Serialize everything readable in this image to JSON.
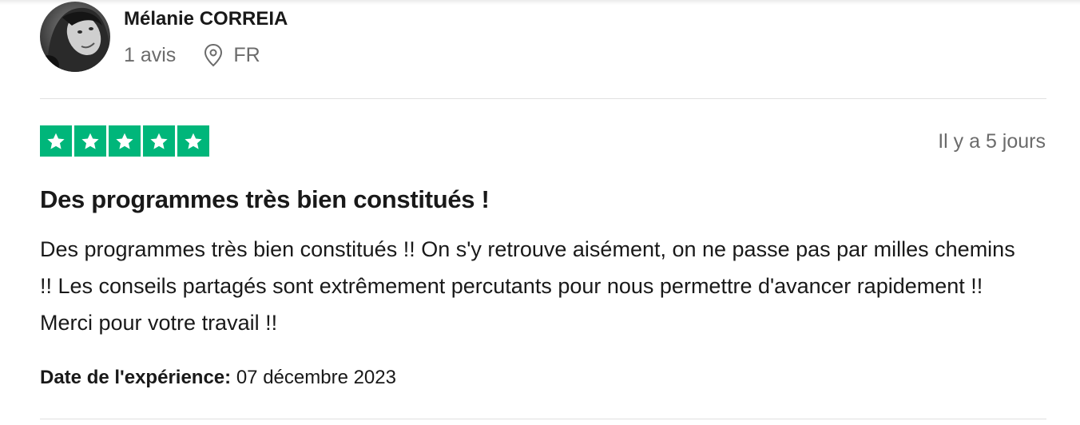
{
  "reviewer": {
    "name": "Mélanie CORREIA",
    "reviews_count": "1 avis",
    "country": "FR"
  },
  "review": {
    "rating": 5,
    "rating_max": 5,
    "star_color": "#00b67a",
    "date": "Il y a 5 jours",
    "title": "Des programmes très bien constitués !",
    "body": "Des programmes très bien constitués !! On s'y retrouve aisément, on ne passe pas par milles chemins !! Les conseils partagés sont extrêmement percutants pour nous permettre d'avancer rapidement !! Merci pour votre travail !!",
    "experience_label": "Date de l'expérience:",
    "experience_date": "07 décembre 2023"
  },
  "icons": {
    "location": "location-pin-icon",
    "star": "star-icon"
  }
}
